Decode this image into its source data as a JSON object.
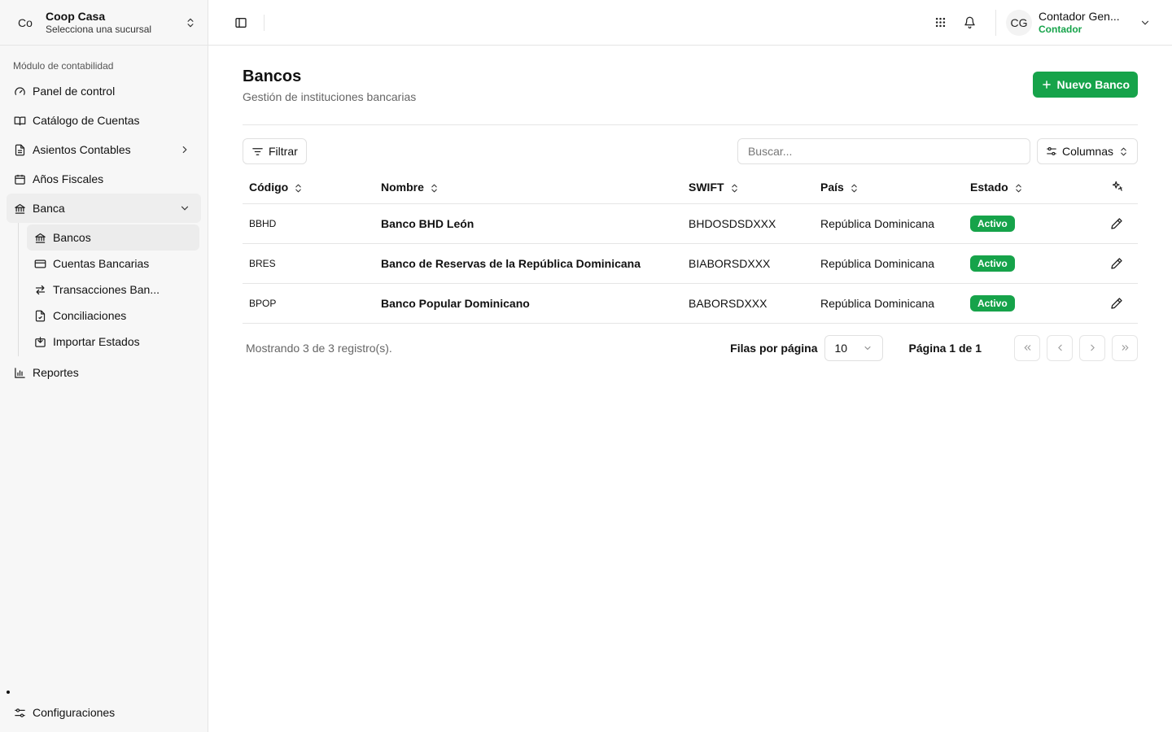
{
  "org": {
    "initials": "Co",
    "name": "Coop Casa",
    "subtitle": "Selecciona una sucursal"
  },
  "sidebar": {
    "section_label": "Módulo de contabilidad",
    "items": [
      {
        "label": "Panel de control",
        "icon": "gauge-icon"
      },
      {
        "label": "Catálogo de Cuentas",
        "icon": "book-icon"
      },
      {
        "label": "Asientos Contables",
        "icon": "file-text-icon"
      },
      {
        "label": "Años Fiscales",
        "icon": "calendar-icon"
      },
      {
        "label": "Banca",
        "icon": "bank-icon"
      }
    ],
    "banca_sub": [
      {
        "label": "Bancos",
        "icon": "bank-icon"
      },
      {
        "label": "Cuentas Bancarias",
        "icon": "credit-card-icon"
      },
      {
        "label": "Transacciones Ban...",
        "icon": "arrows-exchange-icon"
      },
      {
        "label": "Conciliaciones",
        "icon": "file-check-icon"
      },
      {
        "label": "Importar Estados",
        "icon": "import-icon"
      }
    ],
    "reportes": "Reportes",
    "settings": "Configuraciones"
  },
  "user": {
    "initials": "CG",
    "name": "Contador Gen...",
    "role": "Contador"
  },
  "page": {
    "title": "Bancos",
    "subtitle": "Gestión de instituciones bancarias",
    "new_button": "Nuevo Banco"
  },
  "toolbar": {
    "filter_label": "Filtrar",
    "search_placeholder": "Buscar...",
    "columns_label": "Columnas"
  },
  "table": {
    "headers": {
      "code": "Código",
      "name": "Nombre",
      "swift": "SWIFT",
      "country": "País",
      "status": "Estado"
    },
    "rows": [
      {
        "code": "BBHD",
        "name": "Banco BHD León",
        "swift": "BHDOSDSDXXX",
        "country": "República Dominicana",
        "status": "Activo"
      },
      {
        "code": "BRES",
        "name": "Banco de Reservas de la República Dominicana",
        "swift": "BIABORSDXXX",
        "country": "República Dominicana",
        "status": "Activo"
      },
      {
        "code": "BPOP",
        "name": "Banco Popular Dominicano",
        "swift": "BABORSDXXX",
        "country": "República Dominicana",
        "status": "Activo"
      }
    ]
  },
  "pagination": {
    "count_text": "Mostrando 3 de 3 registro(s).",
    "rows_per_page_label": "Filas por página",
    "rows_per_page": "10",
    "page_info": "Página 1 de 1"
  },
  "colors": {
    "accent": "#16a34a"
  }
}
